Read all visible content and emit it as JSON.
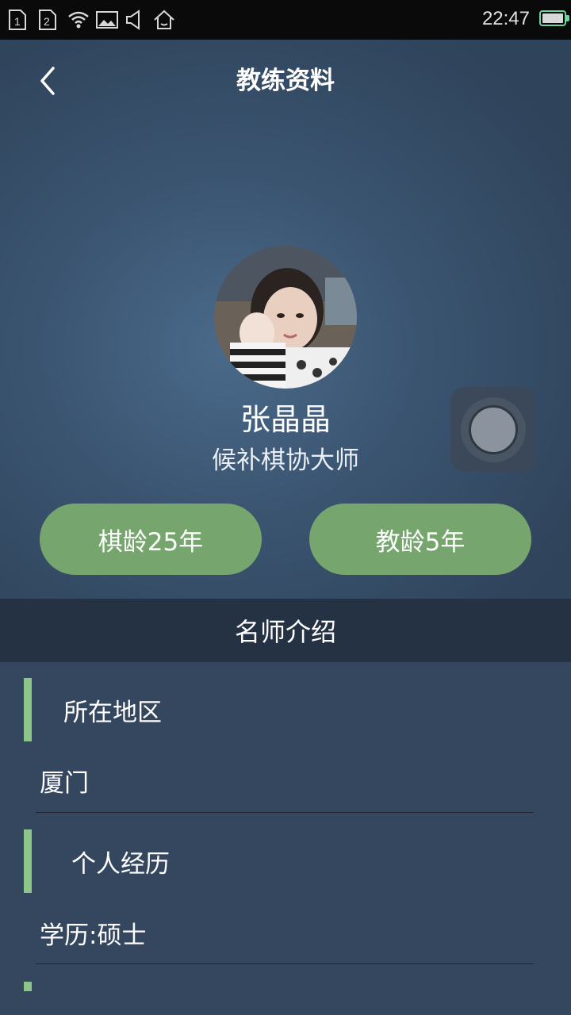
{
  "status_bar": {
    "time": "22:47",
    "sim1": "1",
    "sim2": "2",
    "icons": [
      "sim-1-icon",
      "sim-2-icon",
      "wifi-icon",
      "image-icon",
      "volume-icon",
      "home-icon",
      "battery-icon"
    ]
  },
  "header": {
    "title": "教练资料",
    "back_icon": "chevron-left-icon"
  },
  "profile": {
    "name": "张晶晶",
    "title": "候补棋协大师",
    "avatar": "coach-avatar-photo"
  },
  "stats": {
    "chess_age": "棋龄25年",
    "teaching_age": "教龄5年"
  },
  "section": {
    "title": "名师介绍"
  },
  "details": {
    "region_label": "所在地区",
    "region_value": "厦门",
    "experience_label": "个人经历",
    "experience_value": "学历:硕士"
  },
  "colors": {
    "accent_green": "#8dc68a",
    "pill_green": "#76a66e",
    "section_bar": "#243244",
    "background": "#34475e"
  }
}
